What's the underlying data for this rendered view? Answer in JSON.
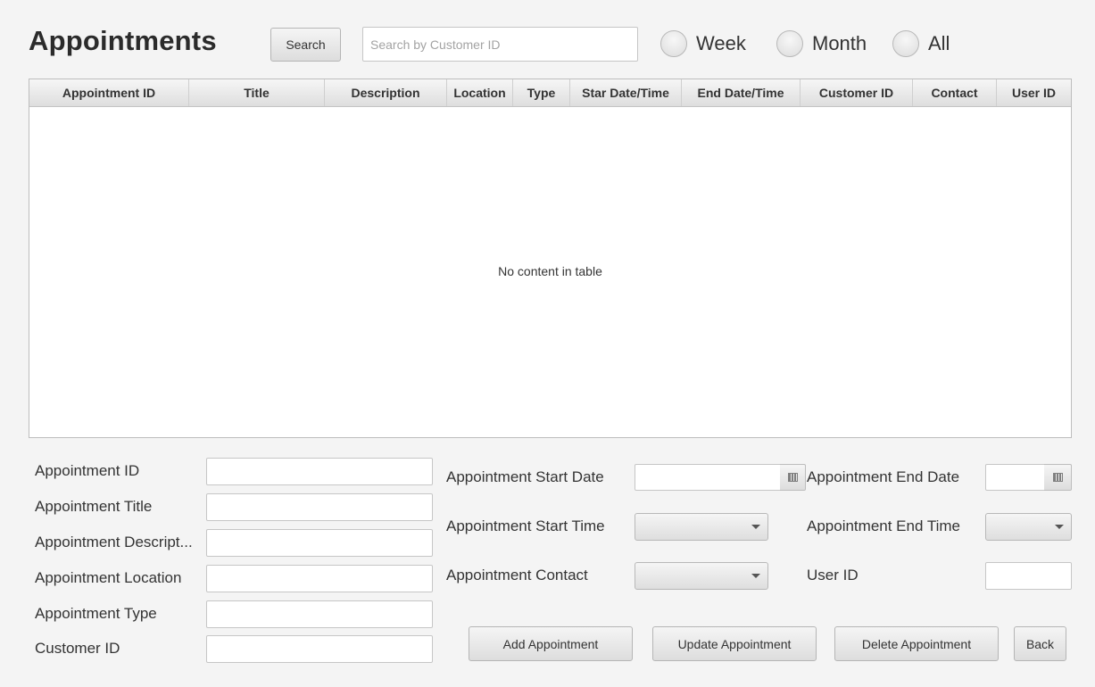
{
  "page": {
    "title": "Appointments"
  },
  "toolbar": {
    "search_label": "Search",
    "search_placeholder": "Search by Customer ID",
    "filters": [
      {
        "label": "Week"
      },
      {
        "label": "Month"
      },
      {
        "label": "All"
      }
    ]
  },
  "table": {
    "columns": [
      "Appointment ID",
      "Title",
      "Description",
      "Location",
      "Type",
      "Star Date/Time",
      "End Date/Time",
      "Customer ID",
      "Contact",
      "User ID"
    ],
    "empty_text": "No content in table"
  },
  "form": {
    "left": [
      "Appointment ID",
      "Appointment Title",
      "Appointment Descript...",
      "Appointment Location",
      "Appointment Type",
      "Customer ID"
    ],
    "start_date_label": "Appointment Start Date",
    "start_time_label": "Appointment Start Time",
    "contact_label": "Appointment Contact",
    "end_date_label": "Appointment End Date",
    "end_time_label": "Appointment End Time",
    "user_id_label": "User ID"
  },
  "actions": {
    "add": "Add Appointment",
    "update": "Update Appointment",
    "delete": "Delete Appointment",
    "back": "Back"
  }
}
